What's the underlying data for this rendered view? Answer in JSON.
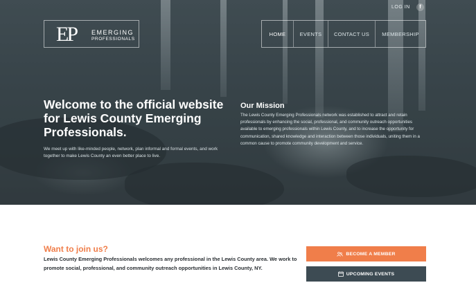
{
  "topbar": {
    "login_label": "LOG IN",
    "facebook_icon": "facebook-icon",
    "facebook_glyph": "f"
  },
  "logo": {
    "initials": "EP",
    "word1": "EMERGING",
    "word2": "PROFESSIONALS"
  },
  "nav": {
    "items": [
      {
        "label": "HOME",
        "active": true
      },
      {
        "label": "EVENTS",
        "active": false
      },
      {
        "label": "CONTACT US",
        "active": false
      },
      {
        "label": "MEMBERSHIP",
        "active": false
      }
    ]
  },
  "hero": {
    "title": "Welcome to the official website for Lewis County Emerging Professionals.",
    "subtitle": "We meet up with like-minded people, network, plan informal and formal events, and work together to make Lewis County an even better place to live.",
    "mission_title": "Our Mission",
    "mission_text": "The Lewis County Emerging Professionals network was established to attract and retain professionals by enhancing the social, professional, and community outreach opportunities available to emerging professionals within Lewis County, and to increase the opportunity for communication, shared knowledge and interaction between those individuals, uniting them in a common cause to promote community development and service."
  },
  "join": {
    "title": "Want to join us?",
    "text": "Lewis County Emerging Professionals welcomes any professional in the Lewis County area. We work to promote social, professional, and community outreach opportunities in Lewis County, NY."
  },
  "buttons": {
    "member_label": "BECOME A MEMBER",
    "member_icon": "users-icon",
    "events_label": "UPCOMING EVENTS",
    "events_icon": "calendar-icon"
  },
  "colors": {
    "accent": "#f07e4a",
    "dark_button": "#3d4b53",
    "hero_overlay": "#2e3c44"
  }
}
